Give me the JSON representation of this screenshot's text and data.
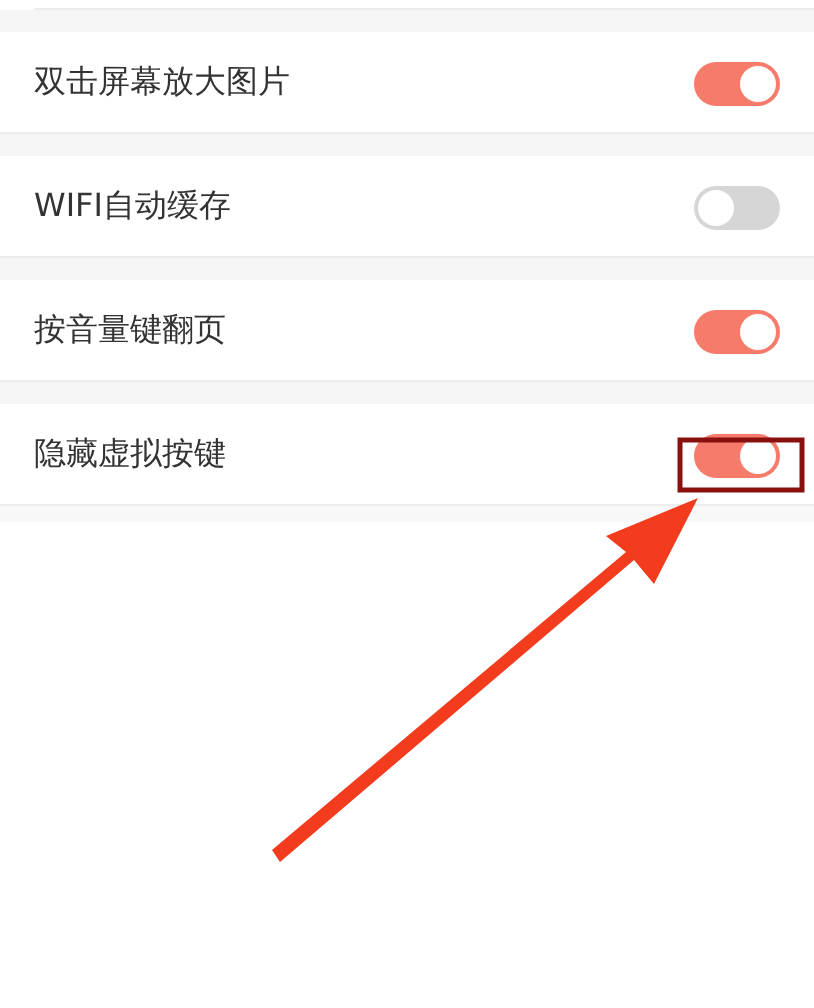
{
  "settings": [
    {
      "label": "双击屏幕放大图片",
      "on": true
    },
    {
      "label": "WIFI自动缓存",
      "on": false
    },
    {
      "label": "按音量键翻页",
      "on": true
    },
    {
      "label": "隐藏虚拟按键",
      "on": true
    }
  ]
}
